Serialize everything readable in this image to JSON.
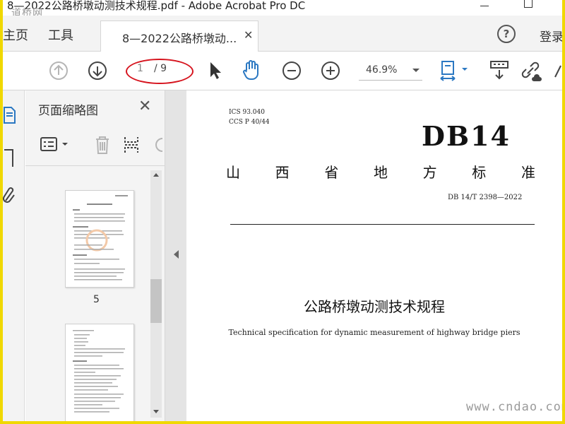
{
  "window": {
    "title": "8—2022公路桥墩动测技术规程.pdf - Adobe Acrobat Pro DC",
    "watermark_top": "道桥网"
  },
  "menu": {
    "home": "主页",
    "tools": "工具",
    "tab_label": "8—2022公路桥墩动...",
    "login": "登录"
  },
  "toolbar": {
    "page_current": "1",
    "page_total": "/ 9",
    "zoom": "46.9%"
  },
  "thumbnails": {
    "title": "页面缩略图",
    "page_label": "5"
  },
  "document": {
    "ics": "ICS  93.040",
    "ccs": "CCS  P  40/44",
    "logo": "DB14",
    "title_chars": [
      "山",
      "西",
      "省",
      "地",
      "方",
      "标",
      "准"
    ],
    "std_number": "DB 14/T  2398—2022",
    "cn_title": "公路桥墩动测技术规程",
    "en_title": "Technical specification for dynamic measurement of highway bridge piers"
  },
  "watermark_bottom": "www.cndao.com",
  "colors": {
    "frame": "#f0d800",
    "icon_blue": "#2b78c2",
    "annotation_red": "#d6141e"
  }
}
